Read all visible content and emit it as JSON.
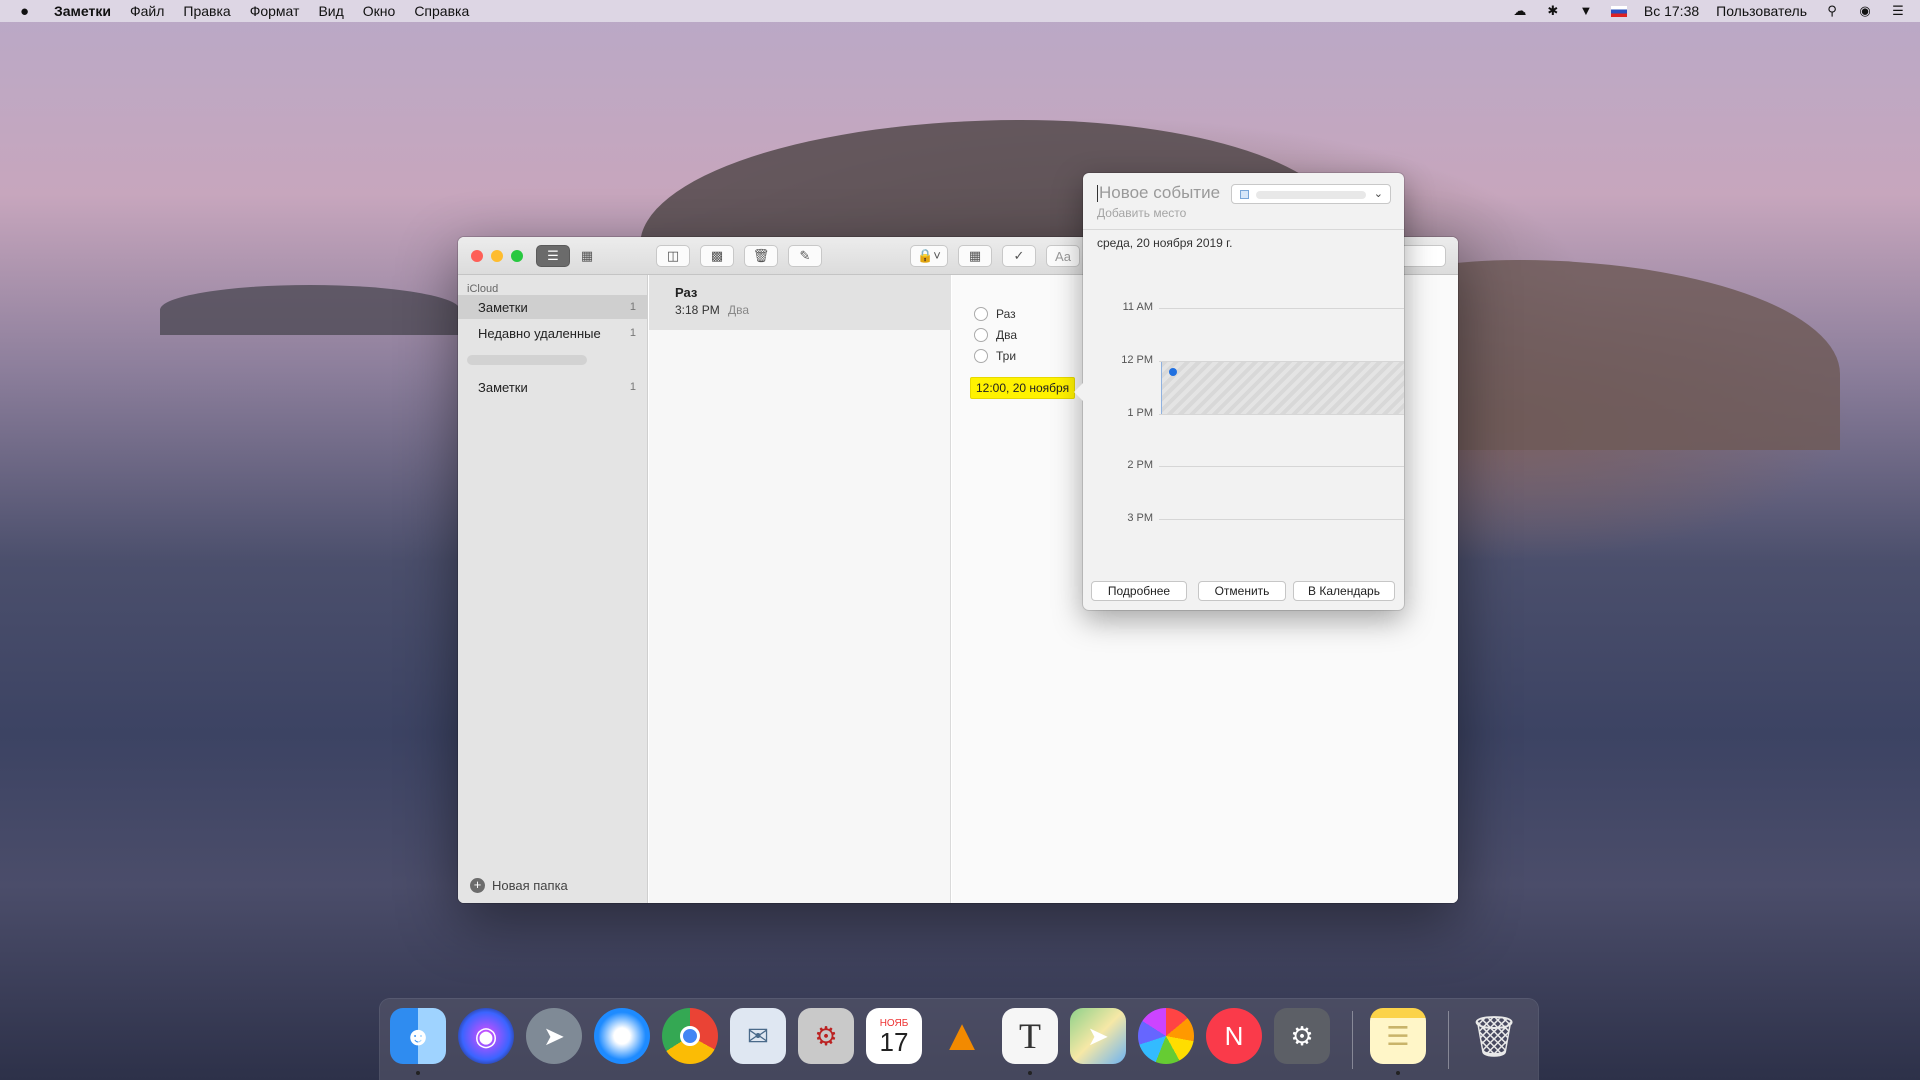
{
  "menubar": {
    "apple": "",
    "app_name": "Заметки",
    "items": [
      "Файл",
      "Правка",
      "Формат",
      "Вид",
      "Окно",
      "Справка"
    ],
    "clock": "Вс 17:38",
    "user": "Пользователь"
  },
  "sidebar": {
    "account": "iCloud",
    "folders": [
      {
        "label": "Заметки",
        "count": "1"
      },
      {
        "label": "Недавно удаленные",
        "count": "1"
      },
      {
        "label": "Заметки",
        "count": "1"
      }
    ],
    "new_folder": "Новая папка"
  },
  "note_list": {
    "title": "Раз",
    "time": "3:18 PM",
    "preview": "Два"
  },
  "editor": {
    "checklist": [
      "Раз",
      "Два",
      "Три"
    ],
    "date_chip": "12:00, 20 ноября",
    "format_button": "Aa"
  },
  "event_popover": {
    "title": "Новое событие",
    "location_placeholder": "Добавить место",
    "date": "среда, 20 ноября 2019 г.",
    "hours": [
      "11 AM",
      "12 PM",
      "1 PM",
      "2 PM",
      "3 PM"
    ],
    "buttons": {
      "details": "Подробнее",
      "cancel": "Отменить",
      "add": "В Календарь"
    }
  },
  "dock": {
    "calendar_month": "НОЯБ",
    "calendar_day": "17",
    "textedit_glyph": "T"
  },
  "colors": {
    "date_chip": "#fff200",
    "event_dot": "#2070e0",
    "close": "#fe5f57",
    "minimize": "#febc2e",
    "zoom": "#28c840"
  }
}
